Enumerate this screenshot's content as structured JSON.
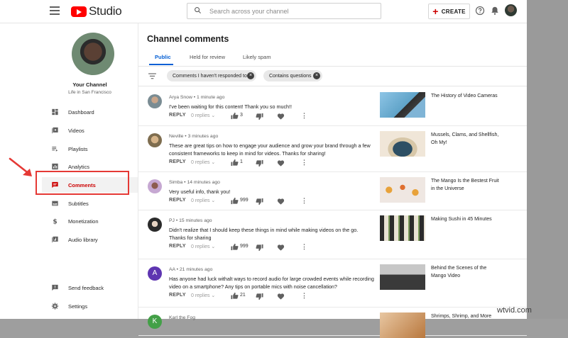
{
  "header": {
    "logo_text": "Studio",
    "search_placeholder": "Search across your channel",
    "create_label": "CREATE"
  },
  "channel": {
    "name": "Your Channel",
    "subtitle": "Life in San Francisco"
  },
  "sidebar": {
    "items": [
      {
        "label": "Dashboard",
        "icon": "dashboard-icon"
      },
      {
        "label": "Videos",
        "icon": "videos-icon"
      },
      {
        "label": "Playlists",
        "icon": "playlists-icon"
      },
      {
        "label": "Analytics",
        "icon": "analytics-icon"
      },
      {
        "label": "Comments",
        "icon": "comments-icon",
        "active": true
      },
      {
        "label": "Subtitles",
        "icon": "subtitles-icon"
      },
      {
        "label": "Monetization",
        "icon": "dollar-icon"
      },
      {
        "label": "Audio library",
        "icon": "audio-library-icon"
      }
    ],
    "footer": [
      {
        "label": "Send feedback",
        "icon": "feedback-icon"
      },
      {
        "label": "Settings",
        "icon": "gear-icon"
      }
    ]
  },
  "main": {
    "title": "Channel comments",
    "tabs": [
      "Public",
      "Held for review",
      "Likely spam"
    ],
    "active_tab": "Public",
    "filters": [
      "Comments I haven't responded to",
      "Contains questions"
    ]
  },
  "comments": [
    {
      "author": "Arya Snow",
      "time": "1 minute ago",
      "text": "I've been waiting for this content! Thank you so much!!",
      "reply_label": "REPLY",
      "replies": "0 replies",
      "likes": "3",
      "video_title": "The History of Video Cameras"
    },
    {
      "author": "Neville",
      "time": "3 minutes ago",
      "text": "These are great tips on how to engage your audience and grow your brand through a few consistent frameworks to keep in mind for videos. Thanks for sharing!",
      "reply_label": "REPLY",
      "replies": "0 replies",
      "likes": "1",
      "video_title": "Mussels, Clams, and Shellfish, Oh My!"
    },
    {
      "author": "Simba",
      "time": "14 minutes ago",
      "text": "Very useful info, thank you!",
      "reply_label": "REPLY",
      "replies": "0 replies",
      "likes": "999",
      "video_title": "The Mango Is the Bestest Fruit in the Universe"
    },
    {
      "author": "PJ",
      "time": "15 minutes ago",
      "text": "Didn't realize that I should keep these things in mind while making videos on the go. Thanks for sharing",
      "reply_label": "REPLY",
      "replies": "0 replies",
      "likes": "999",
      "video_title": "Making Sushi in 45 Minutes"
    },
    {
      "author": "AA",
      "time": "21 minutes ago",
      "text": "Has anyone had luck withalt ways to record audio for large crowded events while recording video on a smartphone? Any tips on portable mics with noise cancellation?",
      "reply_label": "REPLY",
      "replies": "0 replies",
      "likes": "21",
      "avatar_letter": "A",
      "video_title": "Behind the Scenes of the Mango Video"
    },
    {
      "author": "Karl the Fog",
      "time": "",
      "text": "",
      "avatar_letter": "K",
      "video_title": "Shrimps, Shrimp, and More"
    }
  ],
  "watermark": "wtvid.com",
  "colors": {
    "brand_red": "#ff0000",
    "active_red": "#cc0000",
    "tab_blue": "#065fd4",
    "highlight_box": "#e53935"
  }
}
